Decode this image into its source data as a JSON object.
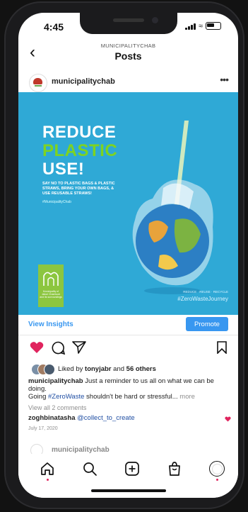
{
  "status": {
    "time": "4:45"
  },
  "header": {
    "account": "MUNICIPALITYCHAB",
    "title": "Posts",
    "back_icon": "chevron-left-icon"
  },
  "post": {
    "username": "municipalitychab",
    "image": {
      "line1": "REDUCE",
      "line2": "PLASTIC",
      "line3": "USE!",
      "subtext": "SAY NO TO PLASTIC BAGS & PLASTIC STRAWS, BRING YOUR OWN BAGS, & USE REUSABLE STRAWS!",
      "hashtag": "#MunicipalityChab",
      "logo_text": "Municipality of Jaloul Chamtoub and its surroundings",
      "rrr": "REDUCE · REUSE · RECYCLE",
      "campaign": "#ZeroWasteJourney",
      "colors": {
        "background": "#2fa9d6",
        "accent": "#7ed321",
        "logo": "#8cc63f"
      }
    },
    "insights_label": "View Insights",
    "promote_label": "Promote",
    "liked_prefix": "Liked by ",
    "liked_user": "tonyjabr",
    "liked_and": " and ",
    "liked_others": "56 others",
    "caption_user": "municipalitychab",
    "caption_text1": " Just a reminder to us all on what we can be doing.",
    "caption_going": "Going ",
    "caption_tag": "#ZeroWaste",
    "caption_text2": " shouldn't be hard or stressful...",
    "caption_more": " more",
    "view_comments": "View all 2 comments",
    "comment_user": "zoghbinatasha",
    "comment_mention": "@collect_to_create",
    "date": "July 17, 2020"
  },
  "next_post": {
    "username": "municipalitychab"
  },
  "tabs": [
    "home-icon",
    "search-icon",
    "new-post-icon",
    "shop-icon",
    "profile-icon"
  ],
  "colors": {
    "link": "#3897f0",
    "like": "#e0245e",
    "hashtag": "#1f4ea3"
  }
}
